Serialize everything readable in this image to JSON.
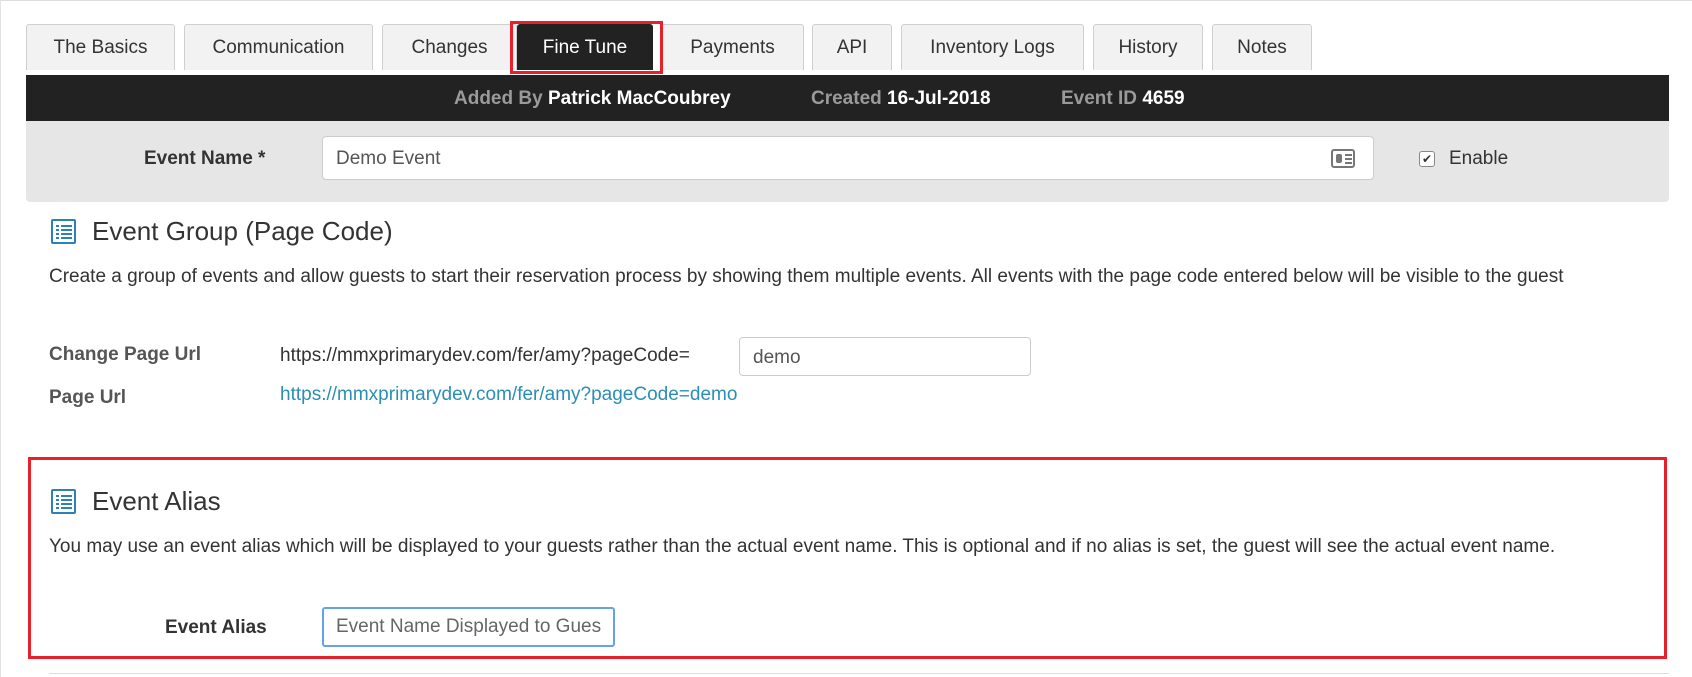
{
  "tabs": [
    {
      "label": "The Basics",
      "active": false
    },
    {
      "label": "Communication",
      "active": false
    },
    {
      "label": "Changes",
      "active": false
    },
    {
      "label": "Fine Tune",
      "active": true
    },
    {
      "label": "Payments",
      "active": false
    },
    {
      "label": "API",
      "active": false
    },
    {
      "label": "Inventory Logs",
      "active": false
    },
    {
      "label": "History",
      "active": false
    },
    {
      "label": "Notes",
      "active": false
    }
  ],
  "info_bar": {
    "added_by_label": "Added By",
    "added_by_value": "Patrick MacCoubrey",
    "created_label": "Created",
    "created_value": "16-Jul-2018",
    "event_id_label": "Event ID",
    "event_id_value": "4659"
  },
  "event_name": {
    "label": "Event Name *",
    "value": "Demo Event",
    "icon": "contact-card-icon",
    "enable_label": "Enable",
    "enabled": true
  },
  "event_group": {
    "title": "Event Group (Page Code)",
    "icon": "list-icon",
    "description": "Create a group of events and allow guests to start their reservation process by showing them multiple events. All events with the page code entered below will be visible to the guest",
    "change_url_label": "Change Page Url",
    "url_prefix": "https://mmxprimarydev.com/fer/amy?pageCode=",
    "page_code": "demo",
    "page_url_label": "Page Url",
    "page_url": "https://mmxprimarydev.com/fer/amy?pageCode=demo"
  },
  "event_alias": {
    "title": "Event Alias",
    "icon": "list-icon",
    "description": "You may use an event alias which will be displayed to your guests rather than the actual event name. This is optional and if no alias is set, the guest will see the actual event name.",
    "label": "Event Alias",
    "placeholder": "Event Name Displayed to Guests"
  },
  "colors": {
    "highlight": "#e8202a",
    "dark_bar": "#222222",
    "link": "#2a8fb3",
    "icon_blue": "#2f7fb8"
  }
}
